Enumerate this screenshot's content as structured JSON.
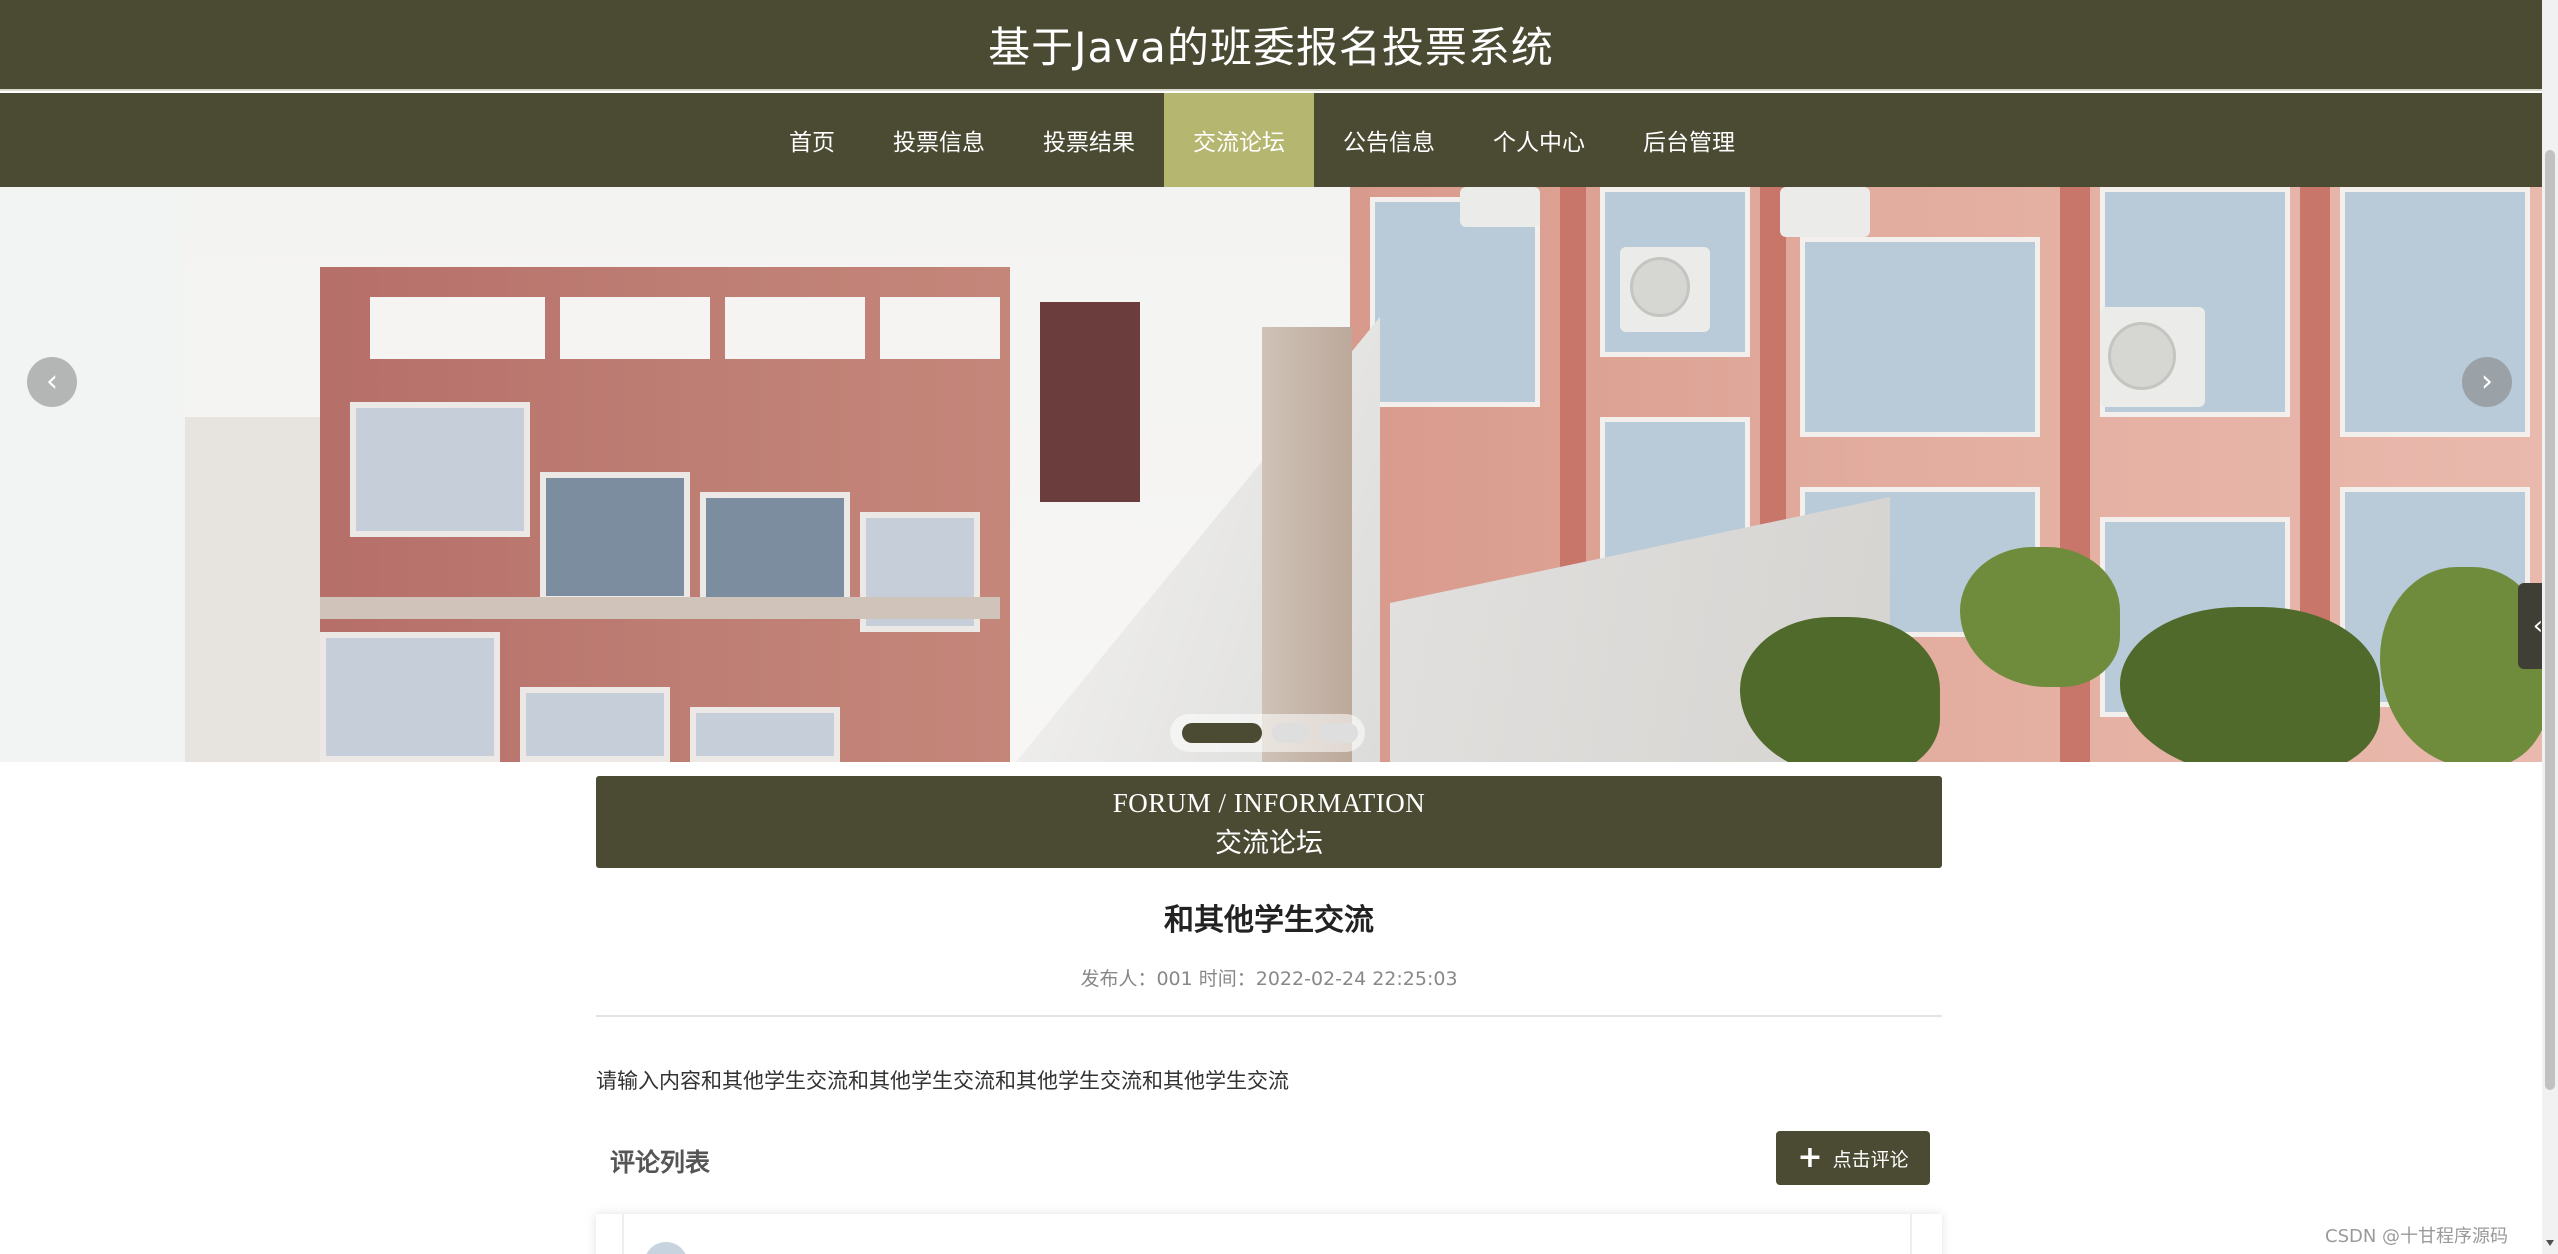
{
  "site": {
    "title": "基于Java的班委报名投票系统"
  },
  "nav": {
    "items": [
      {
        "label": "首页",
        "active": false
      },
      {
        "label": "投票信息",
        "active": false
      },
      {
        "label": "投票结果",
        "active": false
      },
      {
        "label": "交流论坛",
        "active": true
      },
      {
        "label": "公告信息",
        "active": false
      },
      {
        "label": "个人中心",
        "active": false
      },
      {
        "label": "后台管理",
        "active": false
      }
    ]
  },
  "banner": {
    "prev_glyph": "‹",
    "next_glyph": "›",
    "slide_count": 3,
    "active_slide": 1
  },
  "section": {
    "title_en": "FORUM / INFORMATION",
    "title_zh": "交流论坛"
  },
  "post": {
    "title": "和其他学生交流",
    "meta": "发布人：001 时间：2022-02-24 22:25:03",
    "content": "请输入内容和其他学生交流和其他学生交流和其他学生交流和其他学生交流"
  },
  "comments": {
    "label": "评论列表",
    "button_label": "点击评论",
    "button_icon": "plus-icon"
  },
  "side_handle": {
    "glyph": "‹"
  },
  "watermark": "CSDN @十甘程序源码",
  "colors": {
    "primary": "#4b4a33",
    "nav_active": "#b5b66f",
    "text_dark": "#222222",
    "text_meta": "#888888"
  }
}
